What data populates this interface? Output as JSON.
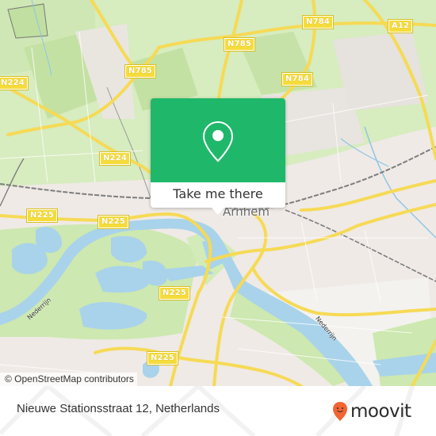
{
  "map": {
    "city_label": "Arnhem",
    "river_labels": [
      "Nederrijn",
      "Nederrijn"
    ],
    "road_shields": [
      {
        "id": "n224-west",
        "label": "N224"
      },
      {
        "id": "n785-north",
        "label": "N785"
      },
      {
        "id": "n785-west",
        "label": "N785"
      },
      {
        "id": "n784-north",
        "label": "N784"
      },
      {
        "id": "n784-mid",
        "label": "N784"
      },
      {
        "id": "a12",
        "label": "A12"
      },
      {
        "id": "n224-center",
        "label": "N224"
      },
      {
        "id": "n225-west",
        "label": "N225"
      },
      {
        "id": "n225-center",
        "label": "N225"
      },
      {
        "id": "n225-south",
        "label": "N225"
      },
      {
        "id": "n225-bottom",
        "label": "N225"
      }
    ],
    "attribution": "© OpenStreetMap contributors",
    "colors": {
      "land": "#efeae6",
      "green": "#cde8b0",
      "water": "#a9d3ea",
      "road": "#f6da55",
      "rail": "#8a8a8a"
    }
  },
  "popup": {
    "icon": "location-pin-icon",
    "button_label": "Take me there",
    "color": "#1fb86a"
  },
  "footer": {
    "address": "Nieuwe Stationsstraat 12, Netherlands",
    "logo_text": "moovit",
    "logo_color": "#f26432"
  }
}
